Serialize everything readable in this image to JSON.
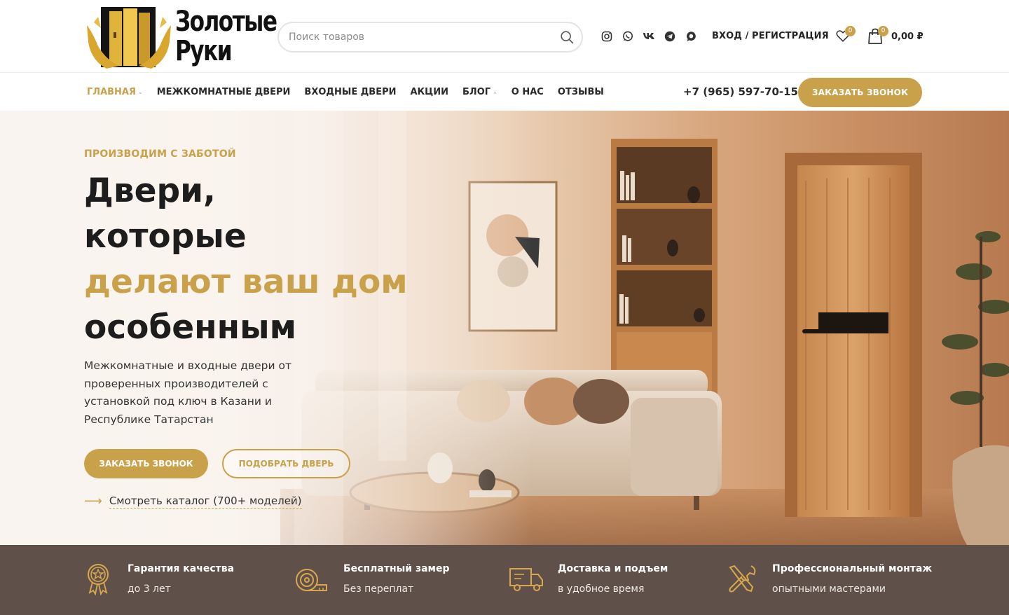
{
  "brand": {
    "name_line1": "Золотые",
    "name_line2": "Руки"
  },
  "search": {
    "placeholder": "Поиск товаров"
  },
  "social": [
    "instagram-icon",
    "whatsapp-icon",
    "vk-icon",
    "telegram-icon",
    "max-icon"
  ],
  "account": {
    "login_label": "ВХОД / РЕГИСТРАЦИЯ"
  },
  "wishlist": {
    "count": "0"
  },
  "cart": {
    "count": "0",
    "total": "0,00 ₽"
  },
  "nav": {
    "items": [
      {
        "label": "ГЛАВНАЯ",
        "active": true,
        "dropdown": true
      },
      {
        "label": "МЕЖКОМНАТНЫЕ ДВЕРИ"
      },
      {
        "label": "ВХОДНЫЕ ДВЕРИ"
      },
      {
        "label": "АКЦИИ"
      },
      {
        "label": "БЛОГ",
        "dropdown": true
      },
      {
        "label": "О НАС"
      },
      {
        "label": "ОТЗЫВЫ"
      }
    ],
    "phone": "+7 (965) 597-70-15",
    "call_button": "ЗАКАЗАТЬ ЗВОНОК"
  },
  "hero": {
    "eyebrow": "ПРОИЗВОДИМ С ЗАБОТОЙ",
    "title_line1": "Двери,",
    "title_line2": "которые",
    "title_line3": "делают ваш дом",
    "title_line4": "особенным",
    "lead": "Межкомнатные и входные двери от проверенных производителей с установкой под ключ в Казани и Республике Татарстан",
    "primary_button": "ЗАКАЗАТЬ ЗВОНОК",
    "secondary_button": "ПОДОБРАТЬ ДВЕРЬ",
    "catalog_link": "Смотреть каталог (700+ моделей)"
  },
  "features": [
    {
      "icon": "award-badge-icon",
      "title": "Гарантия качества",
      "subtitle": "до 3 лет"
    },
    {
      "icon": "tape-measure-icon",
      "title": "Бесплатный замер",
      "subtitle": "Без переплат"
    },
    {
      "icon": "delivery-truck-icon",
      "title": "Доставка и подъем",
      "subtitle": "в удобное время"
    },
    {
      "icon": "tools-icon",
      "title": "Профессиональный монтаж",
      "subtitle": "опытными мастерами"
    }
  ],
  "colors": {
    "accent": "#c9a14a",
    "features_bg": "#5f5049",
    "text_dark": "#1d1d1d"
  }
}
